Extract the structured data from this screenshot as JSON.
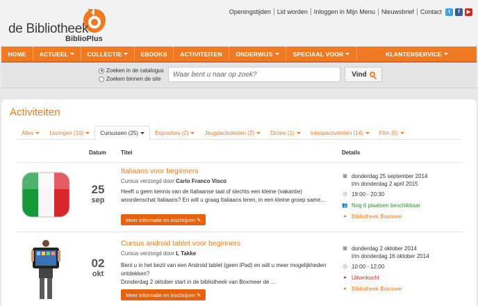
{
  "brand": {
    "name": "de Bibliotheek",
    "sub": "BiblioPlus",
    "accent": "#ef7a22"
  },
  "toplinks": [
    "Openingstijden",
    "Lid worden",
    "Inloggen in Mijn Menu",
    "Nieuwsbrief",
    "Contact"
  ],
  "social": [
    "twitter-icon",
    "facebook-icon",
    "youtube-icon"
  ],
  "nav": [
    {
      "label": "HOME",
      "dropdown": false
    },
    {
      "label": "ACTUEEL",
      "dropdown": true
    },
    {
      "label": "COLLECTIE",
      "dropdown": true
    },
    {
      "label": "EBOOKS",
      "dropdown": false
    },
    {
      "label": "ACTIVITEITEN",
      "dropdown": false
    },
    {
      "label": "ONDERWIJS",
      "dropdown": true
    },
    {
      "label": "SPECIAAL VOOR",
      "dropdown": true
    },
    {
      "label": "KLANTENSERVICE",
      "dropdown": true
    }
  ],
  "search": {
    "options": [
      "Zoeken in de catalogus",
      "Zoeken binnen de site"
    ],
    "selected": "Zoeken in de catalogus",
    "placeholder": "Waar bent u naar op zoek?",
    "button": "Vind"
  },
  "page_title": "Activiteiten",
  "tabs": [
    "Alles",
    "Lezingen (10)",
    "Cursussen (25)",
    "Exposities (2)",
    "Jeugdactiviteiten (2)",
    "Dictee (1)",
    "Inloopactiviteiten (14)",
    "Film (5)"
  ],
  "active_tab": "Cursussen (25)",
  "columns": {
    "date": "Datum",
    "title": "Titel",
    "details": "Details"
  },
  "events": [
    {
      "day": "25",
      "month": "sep",
      "title": "Italiaans voor beginners",
      "by_label": "Cursus verzorgd door",
      "by": "Carlo Franco Visco",
      "desc": "Heeft u geen kennis van de Italiaanse taal of slechts een kleine (vakantie) woordenschat Italiaans? En wilt u graag Italiaans leren, in een kleine groep same...",
      "button": "Meer informatie en inschrijven",
      "date_from": "donderdag 25 september 2014",
      "date_to": "t/m donderdag 2 april 2015",
      "time": "19:00 - 20:30",
      "availability": "Nog 6 plaatsen beschikbaar",
      "location": "Bibliotheek Boxmeer"
    },
    {
      "day": "02",
      "month": "okt",
      "title": "Cursus android tablet voor beginners",
      "by_label": "Cursus verzorgd door",
      "by": "L Takke",
      "desc": "Bent u in het bezit van een Android tablet (geen iPad) en wilt u meer mogelijkheden ontdekken?",
      "desc2": "Donderdag 2 oktober start in de bibliotheek van Boxmeer de ...",
      "button": "Meer informatie en inschrijven",
      "date_from": "donderdag 2 oktober 2014",
      "date_to": "t/m donderdag 16 oktober 2014",
      "time": "10:00 - 12:00",
      "availability": "Uitverkocht",
      "location": "Bibliotheek Boxmeer"
    }
  ]
}
